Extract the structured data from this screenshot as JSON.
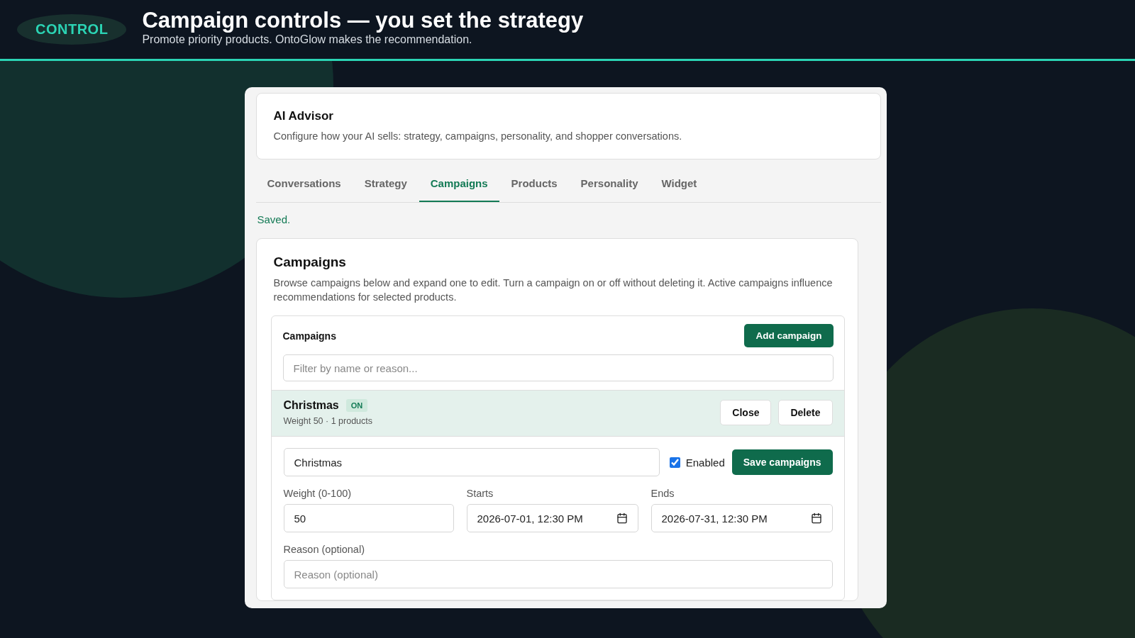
{
  "banner": {
    "badge": "CONTROL",
    "title": "Campaign controls — you set the strategy",
    "subtitle": "Promote priority products. OntoGlow makes the recommendation."
  },
  "advisor": {
    "title": "AI Advisor",
    "description": "Configure how your AI sells: strategy, campaigns, personality, and shopper conversations."
  },
  "tabs": [
    {
      "label": "Conversations",
      "selected": false
    },
    {
      "label": "Strategy",
      "selected": false
    },
    {
      "label": "Campaigns",
      "selected": true
    },
    {
      "label": "Products",
      "selected": false
    },
    {
      "label": "Personality",
      "selected": false
    },
    {
      "label": "Widget",
      "selected": false
    }
  ],
  "status": "Saved.",
  "section": {
    "title": "Campaigns",
    "description": "Browse campaigns below and expand one to edit. Turn a campaign on or off without deleting it. Active campaigns influence recommendations for selected products.",
    "list_title": "Campaigns",
    "add_button": "Add campaign",
    "filter": {
      "placeholder": "Filter by name or reason..."
    },
    "campaigns": [
      {
        "name": "Christmas",
        "badge": "ON",
        "on": true,
        "meta": "Weight 50 · 1 products",
        "expanded": true,
        "buttons": [
          "Close",
          "Delete"
        ],
        "form": {
          "name_value": "Christmas",
          "enabled_label": "Enabled",
          "enabled": true,
          "save_button": "Save campaigns",
          "weight_label": "Weight (0-100)",
          "weight_value": "50",
          "starts_label": "Starts",
          "starts_value": "2026-07-01, 12:30 PM",
          "ends_label": "Ends",
          "ends_value": "2026-07-31, 12:30 PM",
          "reason_label": "Reason (optional)",
          "reason": {
            "placeholder": "Reason (optional)"
          }
        }
      }
    ]
  }
}
